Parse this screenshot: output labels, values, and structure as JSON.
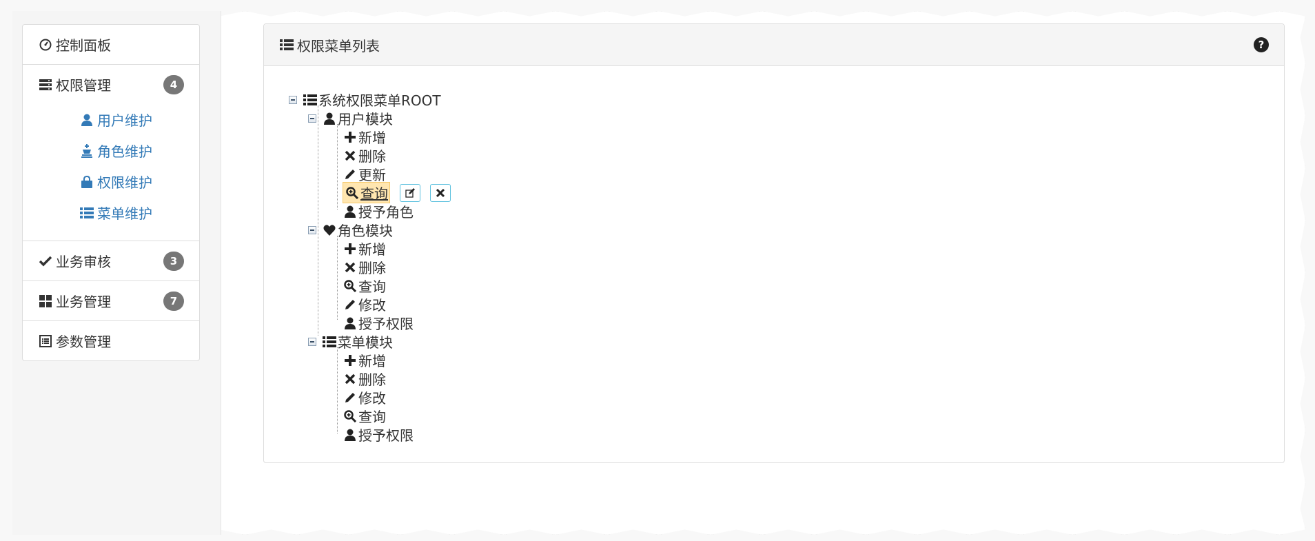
{
  "sidebar": {
    "dashboard": {
      "label": "控制面板",
      "icon": "dashboard-icon"
    },
    "permission": {
      "label": "权限管理",
      "badge": "4",
      "icon": "server-icon",
      "items": [
        {
          "label": "用户维护",
          "icon": "user-icon"
        },
        {
          "label": "角色维护",
          "icon": "king-icon"
        },
        {
          "label": "权限维护",
          "icon": "lock-icon"
        },
        {
          "label": "菜单维护",
          "icon": "list-icon"
        }
      ]
    },
    "audit": {
      "label": "业务审核",
      "badge": "3",
      "icon": "check-icon"
    },
    "business": {
      "label": "业务管理",
      "badge": "7",
      "icon": "th-large-icon"
    },
    "params": {
      "label": "参数管理",
      "icon": "list-alt-icon"
    }
  },
  "panel": {
    "title": "权限菜单列表",
    "help": "?"
  },
  "tree": {
    "root": "系统权限菜单ROOT",
    "user_module": {
      "label": "用户模块",
      "items": [
        "新增",
        "删除",
        "更新",
        "查询",
        "授予角色"
      ]
    },
    "role_module": {
      "label": "角色模块",
      "items": [
        "新增",
        "删除",
        "查询",
        "修改",
        "授予权限"
      ]
    },
    "menu_module": {
      "label": "菜单模块",
      "items": [
        "新增",
        "删除",
        "修改",
        "查询",
        "授予权限"
      ]
    }
  },
  "colors": {
    "link": "#337ab7",
    "badge": "#777777",
    "selected_bg": "#ffe6b0",
    "action_border": "#5bc0de"
  }
}
